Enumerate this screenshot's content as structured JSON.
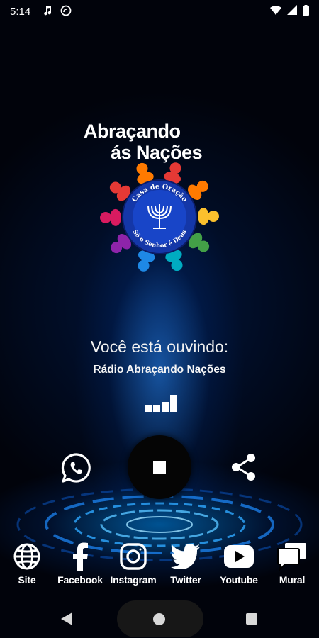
{
  "status_bar": {
    "time": "5:14",
    "icons": [
      "music-note-icon",
      "cast-icon",
      "wifi-icon",
      "signal-icon",
      "battery-icon"
    ]
  },
  "logo": {
    "title_line1": "Abraçando",
    "title_line2": "ás Nações",
    "ring_top": "Casa de Oração",
    "ring_bottom": "Só o Senhor é Deus",
    "person_colors": [
      "#e53935",
      "#ff7a00",
      "#fbc02d",
      "#43a047",
      "#00acc1",
      "#1e88e5",
      "#8e24aa",
      "#d81b60"
    ]
  },
  "player": {
    "listening_label": "Você está ouvindo:",
    "station_name": "Rádio Abraçando Nações",
    "state": "playing"
  },
  "social": [
    {
      "label": "Site",
      "icon": "globe-icon"
    },
    {
      "label": "Facebook",
      "icon": "facebook-icon"
    },
    {
      "label": "Instagram",
      "icon": "instagram-icon"
    },
    {
      "label": "Twitter",
      "icon": "twitter-icon"
    },
    {
      "label": "Youtube",
      "icon": "youtube-icon"
    },
    {
      "label": "Mural",
      "icon": "chat-icon"
    }
  ],
  "colors": {
    "background": "#01030b",
    "glow": "#1e8cff",
    "logo_circle": "#1437a8"
  }
}
